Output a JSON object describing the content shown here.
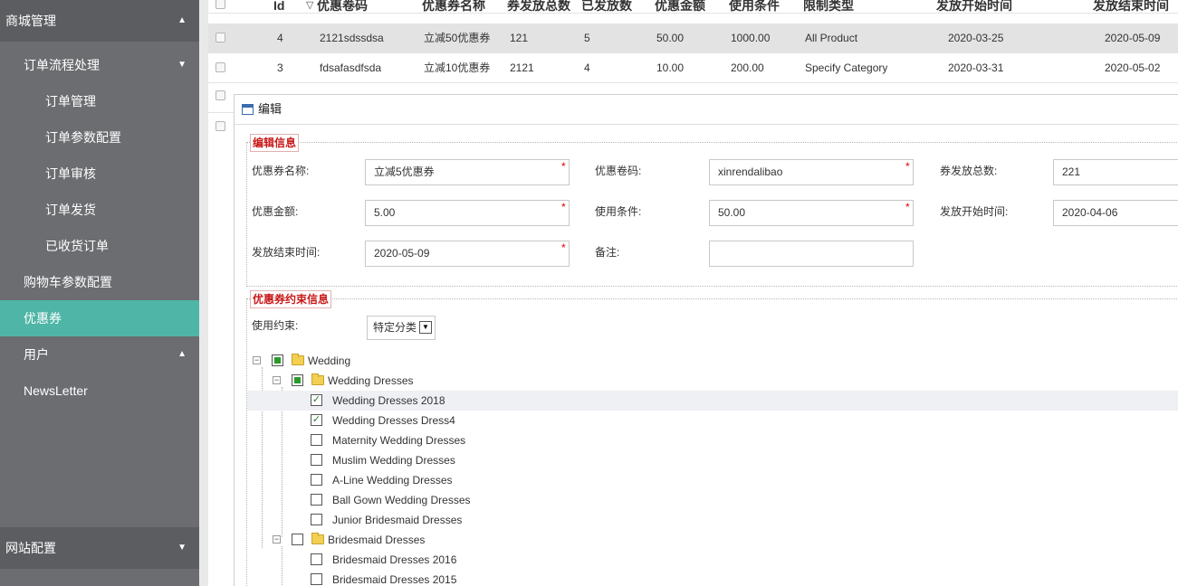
{
  "sidebar": {
    "items": [
      {
        "label": "商城管理",
        "arrow": "▲"
      },
      {
        "label": "订单流程处理",
        "arrow": "▼"
      },
      {
        "label": "订单管理"
      },
      {
        "label": "订单参数配置"
      },
      {
        "label": "订单审核"
      },
      {
        "label": "订单发货"
      },
      {
        "label": "已收货订单"
      },
      {
        "label": "购物车参数配置"
      },
      {
        "label": "优惠券"
      },
      {
        "label": "用户",
        "arrow": "▲"
      },
      {
        "label": "NewsLetter"
      },
      {
        "label": "网站配置",
        "arrow": "▼"
      }
    ],
    "active_color": "#4fb5a6"
  },
  "table": {
    "columns": [
      "Id",
      "优惠卷码",
      "优惠券名称",
      "券发放总数",
      "已发放数",
      "优惠金额",
      "使用条件",
      "限制类型",
      "发放开始时间",
      "发放结束时间"
    ],
    "sort_indicator": "▽",
    "rows": [
      {
        "id": "4",
        "code": "2121sdssdsa",
        "name": "立减50优惠券",
        "total": "121",
        "issued": "5",
        "amount": "50.00",
        "condition": "1000.00",
        "type": "All Product",
        "start": "2020-03-25",
        "end": "2020-05-09"
      },
      {
        "id": "3",
        "code": "fdsafasdfsda",
        "name": "立减10优惠券",
        "total": "2121",
        "issued": "4",
        "amount": "10.00",
        "condition": "200.00",
        "type": "Specify Category",
        "start": "2020-03-31",
        "end": "2020-05-02"
      }
    ]
  },
  "dialog": {
    "title": "编辑",
    "section1": "编辑信息",
    "fields": {
      "name_label": "优惠券名称:",
      "name_value": "立减5优惠券",
      "code_label": "优惠卷码:",
      "code_value": "xinrendalibao",
      "total_label": "券发放总数:",
      "total_value": "221",
      "amount_label": "优惠金额:",
      "amount_value": "5.00",
      "condition_label": "使用条件:",
      "condition_value": "50.00",
      "start_label": "发放开始时间:",
      "start_value": "2020-04-06",
      "end_label": "发放结束时间:",
      "end_value": "2020-05-09",
      "remark_label": "备注:",
      "remark_value": "",
      "required_mark": "*"
    },
    "section2": "优惠券约束信息",
    "constraint_label": "使用约束:",
    "constraint_value": "特定分类",
    "tree": [
      {
        "label": "Wedding",
        "level": 0,
        "state": "partial",
        "folder": true
      },
      {
        "label": "Wedding Dresses",
        "level": 1,
        "state": "partial",
        "folder": true
      },
      {
        "label": "Wedding Dresses 2018",
        "level": 2,
        "state": "checked",
        "highlight": true
      },
      {
        "label": "Wedding Dresses Dress4",
        "level": 2,
        "state": "checked"
      },
      {
        "label": "Maternity Wedding Dresses",
        "level": 2,
        "state": "unchecked"
      },
      {
        "label": "Muslim Wedding Dresses",
        "level": 2,
        "state": "unchecked"
      },
      {
        "label": "A-Line Wedding Dresses",
        "level": 2,
        "state": "unchecked"
      },
      {
        "label": "Ball Gown Wedding Dresses",
        "level": 2,
        "state": "unchecked"
      },
      {
        "label": "Junior Bridesmaid Dresses",
        "level": 2,
        "state": "unchecked"
      },
      {
        "label": "Bridesmaid Dresses",
        "level": 1,
        "state": "unchecked",
        "folder": true
      },
      {
        "label": "Bridesmaid Dresses 2016",
        "level": 2,
        "state": "unchecked"
      },
      {
        "label": "Bridesmaid Dresses 2015",
        "level": 2,
        "state": "unchecked"
      }
    ]
  }
}
